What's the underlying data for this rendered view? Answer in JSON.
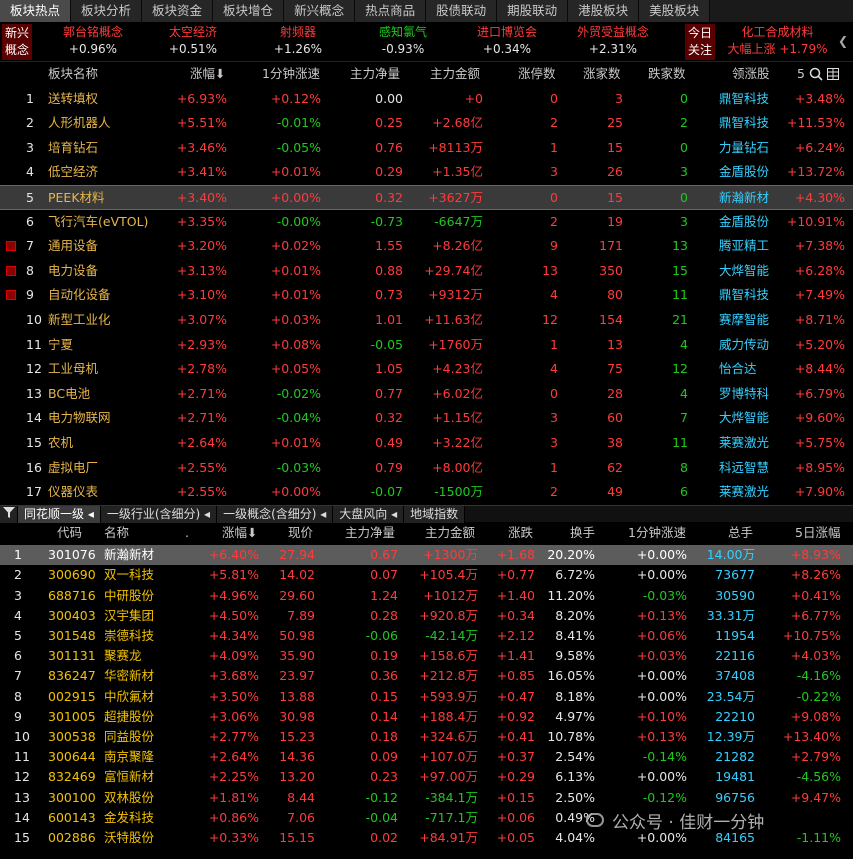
{
  "tabs": [
    "板块热点",
    "板块分析",
    "板块资金",
    "板块增仓",
    "新兴概念",
    "热点商品",
    "股债联动",
    "期股联动",
    "港股板块",
    "美股板块"
  ],
  "concept_bar": {
    "left_label": [
      "新兴",
      "概念"
    ],
    "items": [
      {
        "name": "郭台铭概念",
        "value": "+0.96%",
        "dir": "red"
      },
      {
        "name": "太空经济",
        "value": "+0.51%",
        "dir": "red"
      },
      {
        "name": "射频器",
        "value": "+1.26%",
        "dir": "red"
      },
      {
        "name": "感知氯气",
        "value": "-0.93%",
        "dir": "green"
      },
      {
        "name": "进口博览会",
        "value": "+0.34%",
        "dir": "red"
      },
      {
        "name": "外贸受益概念",
        "value": "+2.31%",
        "dir": "red"
      }
    ],
    "today_label": [
      "今日",
      "关注"
    ],
    "today_item": {
      "name": "化工合成材料",
      "value": "大幅上涨 +1.79%"
    },
    "arrow": "❮"
  },
  "sector_table": {
    "headers": [
      "板块名称",
      "涨幅⬇",
      "1分钟涨速",
      "主力净量",
      "主力金额",
      "涨停数",
      "涨家数",
      "跌家数",
      "领涨股",
      "5"
    ],
    "rows": [
      {
        "no": "1",
        "name": "送转填权",
        "chg": "+6.93%",
        "speed": "+0.12%",
        "net": "0.00",
        "amt": "+0",
        "limit": "0",
        "up": "3",
        "down": "0",
        "lead": "鼎智科技",
        "lchg": "+3.48%",
        "mark": false
      },
      {
        "no": "2",
        "name": "人形机器人",
        "chg": "+5.51%",
        "speed": "-0.01%",
        "net": "0.25",
        "amt": "+2.68亿",
        "limit": "2",
        "up": "25",
        "down": "2",
        "lead": "鼎智科技",
        "lchg": "+11.53%",
        "mark": false
      },
      {
        "no": "3",
        "name": "培育钻石",
        "chg": "+3.46%",
        "speed": "-0.05%",
        "net": "0.76",
        "amt": "+8113万",
        "limit": "1",
        "up": "15",
        "down": "0",
        "lead": "力量钻石",
        "lchg": "+6.24%",
        "mark": false
      },
      {
        "no": "4",
        "name": "低空经济",
        "chg": "+3.41%",
        "speed": "+0.01%",
        "net": "0.29",
        "amt": "+1.35亿",
        "limit": "3",
        "up": "26",
        "down": "3",
        "lead": "金盾股份",
        "lchg": "+13.72%",
        "mark": false
      },
      {
        "no": "5",
        "name": "PEEK材料",
        "chg": "+3.40%",
        "speed": "+0.00%",
        "net": "0.32",
        "amt": "+3627万",
        "limit": "0",
        "up": "15",
        "down": "0",
        "lead": "新瀚新材",
        "lchg": "+4.30%",
        "mark": false
      },
      {
        "no": "6",
        "name": "飞行汽车(eVTOL)",
        "chg": "+3.35%",
        "speed": "-0.00%",
        "net": "-0.73",
        "amt": "-6647万",
        "limit": "2",
        "up": "19",
        "down": "3",
        "lead": "金盾股份",
        "lchg": "+10.91%",
        "mark": false
      },
      {
        "no": "7",
        "name": "通用设备",
        "chg": "+3.20%",
        "speed": "+0.02%",
        "net": "1.55",
        "amt": "+8.26亿",
        "limit": "9",
        "up": "171",
        "down": "13",
        "lead": "腾亚精工",
        "lchg": "+7.38%",
        "mark": true
      },
      {
        "no": "8",
        "name": "电力设备",
        "chg": "+3.13%",
        "speed": "+0.01%",
        "net": "0.88",
        "amt": "+29.74亿",
        "limit": "13",
        "up": "350",
        "down": "15",
        "lead": "大烨智能",
        "lchg": "+6.28%",
        "mark": true
      },
      {
        "no": "9",
        "name": "自动化设备",
        "chg": "+3.10%",
        "speed": "+0.01%",
        "net": "0.73",
        "amt": "+9312万",
        "limit": "4",
        "up": "80",
        "down": "11",
        "lead": "鼎智科技",
        "lchg": "+7.49%",
        "mark": true
      },
      {
        "no": "10",
        "name": "新型工业化",
        "chg": "+3.07%",
        "speed": "+0.03%",
        "net": "1.01",
        "amt": "+11.63亿",
        "limit": "12",
        "up": "154",
        "down": "21",
        "lead": "赛摩智能",
        "lchg": "+8.71%",
        "mark": false
      },
      {
        "no": "11",
        "name": "宁夏",
        "chg": "+2.93%",
        "speed": "+0.08%",
        "net": "-0.05",
        "amt": "+1760万",
        "limit": "1",
        "up": "13",
        "down": "4",
        "lead": "威力传动",
        "lchg": "+5.20%",
        "mark": false
      },
      {
        "no": "12",
        "name": "工业母机",
        "chg": "+2.78%",
        "speed": "+0.05%",
        "net": "1.05",
        "amt": "+4.23亿",
        "limit": "4",
        "up": "75",
        "down": "12",
        "lead": "怡合达",
        "lchg": "+8.44%",
        "mark": false
      },
      {
        "no": "13",
        "name": "BC电池",
        "chg": "+2.71%",
        "speed": "-0.02%",
        "net": "0.77",
        "amt": "+6.02亿",
        "limit": "0",
        "up": "28",
        "down": "4",
        "lead": "罗博特科",
        "lchg": "+6.79%",
        "mark": false
      },
      {
        "no": "14",
        "name": "电力物联网",
        "chg": "+2.71%",
        "speed": "-0.04%",
        "net": "0.32",
        "amt": "+1.15亿",
        "limit": "3",
        "up": "60",
        "down": "7",
        "lead": "大烨智能",
        "lchg": "+9.60%",
        "mark": false
      },
      {
        "no": "15",
        "name": "农机",
        "chg": "+2.64%",
        "speed": "+0.01%",
        "net": "0.49",
        "amt": "+3.22亿",
        "limit": "3",
        "up": "38",
        "down": "11",
        "lead": "莱赛激光",
        "lchg": "+5.75%",
        "mark": false
      },
      {
        "no": "16",
        "name": "虚拟电厂",
        "chg": "+2.55%",
        "speed": "-0.03%",
        "net": "0.79",
        "amt": "+8.00亿",
        "limit": "1",
        "up": "62",
        "down": "8",
        "lead": "科远智慧",
        "lchg": "+8.95%",
        "mark": false
      },
      {
        "no": "17",
        "name": "仪器仪表",
        "chg": "+2.55%",
        "speed": "+0.00%",
        "net": "-0.07",
        "amt": "-1500万",
        "limit": "2",
        "up": "49",
        "down": "6",
        "lead": "莱赛激光",
        "lchg": "+7.90%",
        "mark": false
      }
    ]
  },
  "bottom_tabs": [
    "同花顺一级",
    "一级行业(含细分)",
    "一级概念(含细分)",
    "大盘风向",
    "地域指数"
  ],
  "stock_table": {
    "headers": [
      "代码",
      "名称",
      ".",
      "涨幅⬇",
      "现价",
      "主力净量",
      "主力金额",
      "涨跌",
      "换手",
      "1分钟涨速",
      "总手",
      "5日涨幅"
    ],
    "rows": [
      {
        "no": "1",
        "code": "301076",
        "name": "新瀚新材",
        "chg": "+6.40%",
        "price": "27.94",
        "net": "0.67",
        "amt": "+1300万",
        "diff": "+1.68",
        "turn": "20.20%",
        "speed": "+0.00%",
        "vol": "14.00万",
        "d5": "+8.93%"
      },
      {
        "no": "2",
        "code": "300690",
        "name": "双一科技",
        "chg": "+5.81%",
        "price": "14.02",
        "net": "0.07",
        "amt": "+105.4万",
        "diff": "+0.77",
        "turn": "6.72%",
        "speed": "+0.00%",
        "vol": "73677",
        "d5": "+8.26%"
      },
      {
        "no": "3",
        "code": "688716",
        "name": "中研股份",
        "chg": "+4.96%",
        "price": "29.60",
        "net": "1.24",
        "amt": "+1012万",
        "diff": "+1.40",
        "turn": "11.20%",
        "speed": "-0.03%",
        "vol": "30590",
        "d5": "+0.41%"
      },
      {
        "no": "4",
        "code": "300403",
        "name": "汉宇集团",
        "chg": "+4.50%",
        "price": "7.89",
        "net": "0.28",
        "amt": "+920.8万",
        "diff": "+0.34",
        "turn": "8.20%",
        "speed": "+0.13%",
        "vol": "33.31万",
        "d5": "+6.77%"
      },
      {
        "no": "5",
        "code": "301548",
        "name": "崇德科技",
        "chg": "+4.34%",
        "price": "50.98",
        "net": "-0.06",
        "amt": "-42.14万",
        "diff": "+2.12",
        "turn": "8.41%",
        "speed": "+0.06%",
        "vol": "11954",
        "d5": "+10.75%"
      },
      {
        "no": "6",
        "code": "301131",
        "name": "聚赛龙",
        "chg": "+4.09%",
        "price": "35.90",
        "net": "0.19",
        "amt": "+158.6万",
        "diff": "+1.41",
        "turn": "9.58%",
        "speed": "+0.03%",
        "vol": "22116",
        "d5": "+4.03%"
      },
      {
        "no": "7",
        "code": "836247",
        "name": "华密新材",
        "chg": "+3.68%",
        "price": "23.97",
        "net": "0.36",
        "amt": "+212.8万",
        "diff": "+0.85",
        "turn": "16.05%",
        "speed": "+0.00%",
        "vol": "37408",
        "d5": "-4.16%"
      },
      {
        "no": "8",
        "code": "002915",
        "name": "中欣氟材",
        "chg": "+3.50%",
        "price": "13.88",
        "net": "0.15",
        "amt": "+593.9万",
        "diff": "+0.47",
        "turn": "8.18%",
        "speed": "+0.00%",
        "vol": "23.54万",
        "d5": "-0.22%"
      },
      {
        "no": "9",
        "code": "301005",
        "name": "超捷股份",
        "chg": "+3.06%",
        "price": "30.98",
        "net": "0.14",
        "amt": "+188.4万",
        "diff": "+0.92",
        "turn": "4.97%",
        "speed": "+0.10%",
        "vol": "22210",
        "d5": "+9.08%"
      },
      {
        "no": "10",
        "code": "300538",
        "name": "同益股份",
        "chg": "+2.77%",
        "price": "15.23",
        "net": "0.18",
        "amt": "+324.6万",
        "diff": "+0.41",
        "turn": "10.78%",
        "speed": "+0.13%",
        "vol": "12.39万",
        "d5": "+13.40%"
      },
      {
        "no": "11",
        "code": "300644",
        "name": "南京聚隆",
        "chg": "+2.64%",
        "price": "14.36",
        "net": "0.09",
        "amt": "+107.0万",
        "diff": "+0.37",
        "turn": "2.54%",
        "speed": "-0.14%",
        "vol": "21282",
        "d5": "+2.79%"
      },
      {
        "no": "12",
        "code": "832469",
        "name": "富恒新材",
        "chg": "+2.25%",
        "price": "13.20",
        "net": "0.23",
        "amt": "+97.00万",
        "diff": "+0.29",
        "turn": "6.13%",
        "speed": "+0.00%",
        "vol": "19481",
        "d5": "-4.56%"
      },
      {
        "no": "13",
        "code": "300100",
        "name": "双林股份",
        "chg": "+1.81%",
        "price": "8.44",
        "net": "-0.12",
        "amt": "-384.1万",
        "diff": "+0.15",
        "turn": "2.50%",
        "speed": "-0.12%",
        "vol": "96756",
        "d5": "+9.47%"
      },
      {
        "no": "14",
        "code": "600143",
        "name": "金发科技",
        "chg": "+0.86%",
        "price": "7.06",
        "net": "-0.04",
        "amt": "-717.1万",
        "diff": "+0.06",
        "turn": "0.49%",
        "speed": "",
        "vol": "",
        "d5": ""
      },
      {
        "no": "15",
        "code": "002886",
        "name": "沃特股份",
        "chg": "+0.33%",
        "price": "15.15",
        "net": "0.02",
        "amt": "+84.91万",
        "diff": "+0.05",
        "turn": "4.04%",
        "speed": "+0.00%",
        "vol": "84165",
        "d5": "-1.11%"
      }
    ]
  },
  "watermark": "公众号 · 佳财一分钟"
}
